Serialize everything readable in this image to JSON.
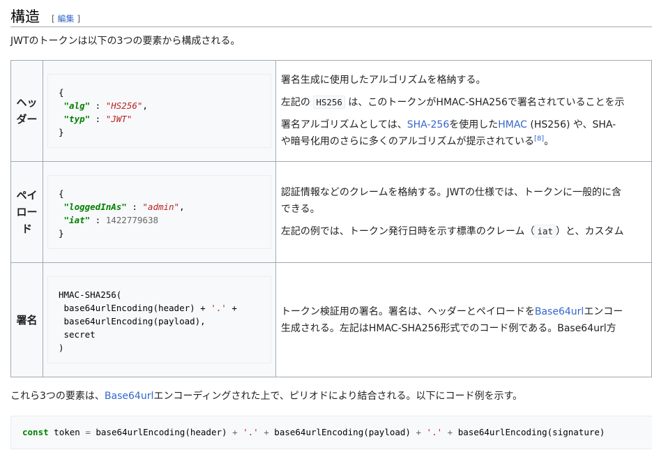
{
  "section": {
    "title": "構造",
    "edit_open": "[ ",
    "edit_label": "編集",
    "edit_close": " ]"
  },
  "intro": "JWTのトークンは以下の3つの要素から構成される。",
  "rows": [
    {
      "header": "ヘッダー",
      "code": {
        "open": "{",
        "k1": "\"alg\"",
        "sep1": " : ",
        "v1": "\"HS256\"",
        "comma1": ",",
        "k2": "\"typ\"",
        "sep2": " : ",
        "v2": "\"JWT\"",
        "close": "}"
      },
      "desc": {
        "p1": "署名生成に使用したアルゴリズムを格納する。",
        "p2_pre": "左記の ",
        "p2_code": "HS256",
        "p2_post": " は、このトークンがHMAC-SHA256で署名されていることを示",
        "p3_pre": "署名アルゴリズムとしては、",
        "p3_link1": "SHA-256",
        "p3_mid": "を使用した",
        "p3_link2": "HMAC",
        "p3_post": " (HS256) や、SHA-",
        "p3_line2": "や暗号化用のさらに多くのアルゴリズムが提示されている",
        "p3_ref": "[8]",
        "p3_end": "。"
      }
    },
    {
      "header": "ペイロード",
      "code": {
        "open": "{",
        "k1": "\"loggedInAs\"",
        "sep1": " : ",
        "v1": "\"admin\"",
        "comma1": ",",
        "k2": "\"iat\"",
        "sep2": " : ",
        "v2": "1422779638",
        "close": "}"
      },
      "desc": {
        "p1_line1": "認証情報などのクレームを格納する。JWTの仕様では、トークンに一般的に含",
        "p1_line2": "できる。",
        "p2_pre": "左記の例では、トークン発行日時を示す標準のクレーム（",
        "p2_code": "iat",
        "p2_post": "）と、カスタム"
      }
    },
    {
      "header": "署名",
      "code": {
        "l1": "HMAC-SHA256(",
        "l2_pre": " base64urlEncoding(header) + ",
        "l2_str": "'.'",
        "l2_post": " +",
        "l3": " base64urlEncoding(payload),",
        "l4": " secret",
        "l5": ")"
      },
      "desc": {
        "line1_pre": "トークン検証用の署名。署名は、ヘッダーとペイロードを",
        "line1_link": "Base64url",
        "line1_post": "エンコー",
        "line2": "生成される。左記はHMAC-SHA256形式でのコード例である。Base64url方"
      }
    }
  ],
  "outro": {
    "pre": "これら3つの要素は、",
    "link": "Base64url",
    "post": "エンコーディングされた上で、ピリオドにより結合される。以下にコード例を示す。"
  },
  "bottom_code": {
    "kw": "const",
    "t1": " token ",
    "eq": "=",
    "t2": " base64urlEncoding(header) ",
    "plus1": "+",
    "s1": " '.' ",
    "plus2": "+",
    "t3": " base64urlEncoding(payload) ",
    "plus3": "+",
    "s2": " '.' ",
    "plus4": "+",
    "t4": " base64urlEncoding(signature)"
  }
}
